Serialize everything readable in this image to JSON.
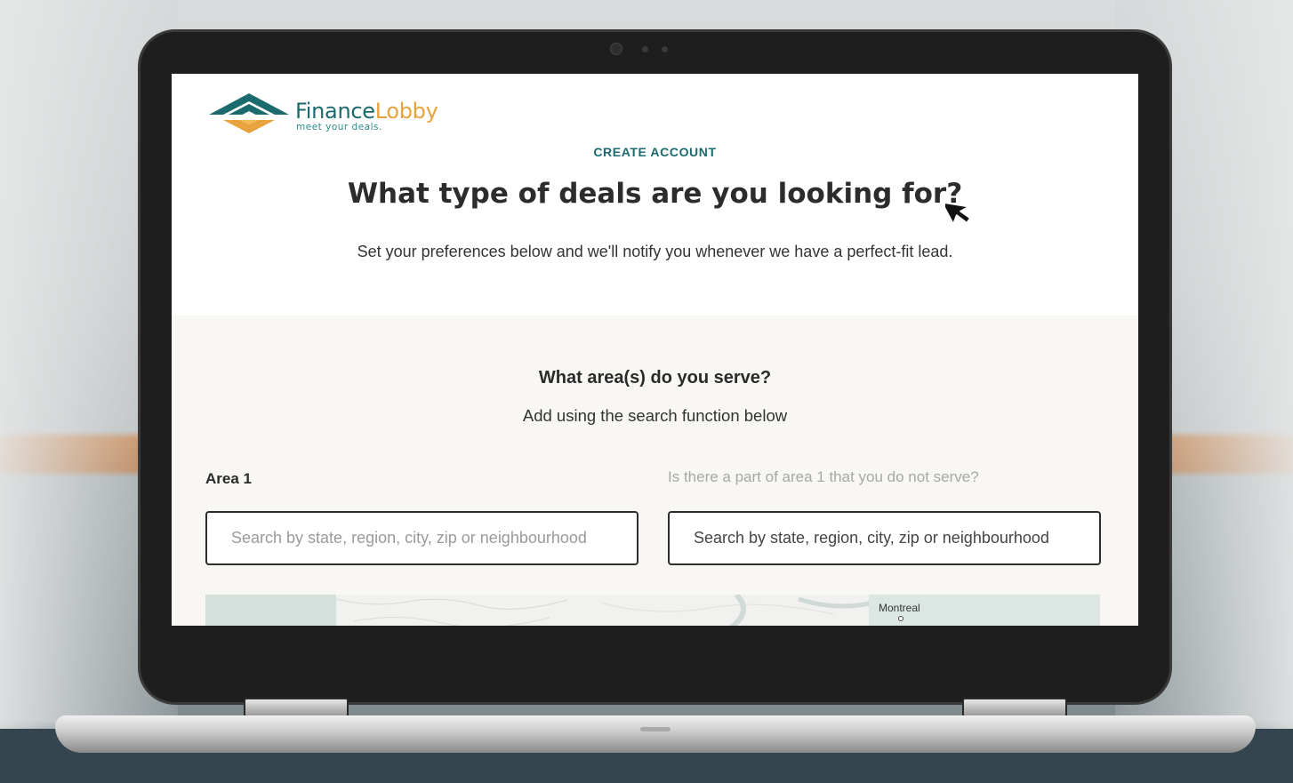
{
  "brand": {
    "name_part1": "Finance",
    "name_part2": "Lobby",
    "tagline": "meet your deals.",
    "colors": {
      "teal": "#1a6a6e",
      "orange": "#e9a23b"
    }
  },
  "header": {
    "eyebrow": "CREATE ACCOUNT",
    "title": "What type of deals are you looking for?",
    "subtitle": "Set your preferences below and we'll notify you whenever we have a perfect-fit lead."
  },
  "areas": {
    "question": "What area(s) do you serve?",
    "helper": "Add using the search function below",
    "area1_label": "Area 1",
    "exclude_label": "Is there a part of area 1 that you do not serve?",
    "area1_placeholder": "Search by state, region, city, zip or neighbourhood",
    "exclude_value": "Search by state, region, city, zip or neighbourhood"
  },
  "map": {
    "city_label": "Montreal"
  },
  "icons": {
    "cursor": "arrow-cursor-icon",
    "logo": "financelobby-logo-icon"
  }
}
